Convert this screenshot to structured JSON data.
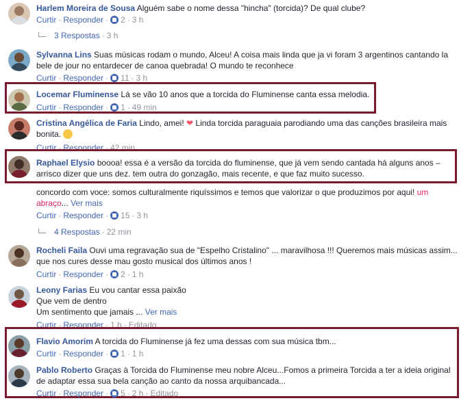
{
  "labels": {
    "curtir": "Curtir",
    "responder": "Responder",
    "ver_mais": "Ver mais",
    "editado": "Editado",
    "sep": "·"
  },
  "comments": [
    {
      "name": "Harlem Moreira de Sousa",
      "text": "Alguém sabe o nome dessa \"hincha\" (torcida)? De qual clube?",
      "likes": "2",
      "time": "3 h"
    },
    {
      "name": "Sylvanna Lins",
      "text": "Suas músicas rodam o mundo, Alceu! A coisa mais linda que ja vi foram 3 argentinos cantando la bele de jour no entardecer de canoa quebrada! O mundo te reconhece",
      "likes": "11",
      "time": "3 h"
    },
    {
      "name": "Locemar Fluminense",
      "text": "Lá se vão 10 anos que a torcida do Fluminense canta essa melodia.",
      "likes": "1",
      "time": "49 min"
    },
    {
      "name": "Cristina Angélica de Faria",
      "text_a": "Lindo, amei!",
      "heart": "❤",
      "text_b": "Linda torcida paraguaia parodiando uma das canções brasileira mais bonita.",
      "time": "42 min"
    },
    {
      "name": "Raphael Elysio",
      "text": "boooa! essa é a versão da torcida do fluminense, que já vem sendo cantada há alguns anos – arrisco dizer que uns dez. tem outra do gonzagão, mais recente, e que faz muito sucesso."
    },
    {
      "text_a": "concordo com voce: somos culturalmente riquíssimos e temos que valorizar o que produzimos por aqui!",
      "text_red": "um abraço",
      "ellipsis": "...",
      "likes": "15",
      "time": "3 h"
    },
    {
      "name": "Rocheli Faila",
      "text": "Ouvi uma regravação sua de \"Espelho Cristalino\" ... maravilhosa !!! Queremos mais músicas assim... que nos cures desse mau gosto musical dos últimos anos !",
      "likes": "2",
      "time": "1 h"
    },
    {
      "name": "Leony Farias",
      "line1": "Eu vou cantar essa paixão",
      "line2": "Que vem de dentro",
      "line3": "Um sentimento que jamais ...",
      "time": "1 h"
    },
    {
      "name": "Flavio Amorim",
      "text": "A torcida do Fluminense já fez uma dessas com sua música tbm...",
      "likes": "1",
      "time": "1 h"
    },
    {
      "name": "Pablo Roberto",
      "text": "Graças à Torcida do Fluminense meu nobre Alceu...Fomos a primeira Torcida a ter a ideia original de adaptar essa sua bela canção ao canto da nossa arquibancada...",
      "likes": "5",
      "time": "2 h"
    }
  ],
  "replies": [
    {
      "label": "3 Respostas",
      "time": "3 h"
    },
    {
      "label": "4 Respostas",
      "time": "22 min"
    }
  ],
  "colors": {
    "link": "#4267b2",
    "name": "#365899",
    "meta": "#90949c",
    "highlight": "#7b1a2c"
  }
}
